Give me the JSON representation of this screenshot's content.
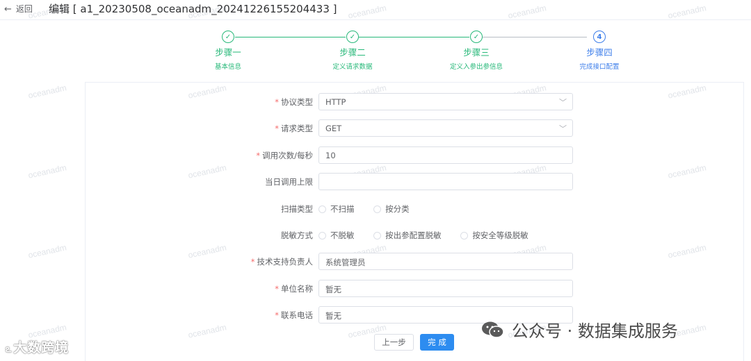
{
  "header": {
    "back_label": "返回",
    "title": "编辑 [ a1_20230508_oceanadm_20241226155204433 ]"
  },
  "watermark": "oceanadm",
  "steps": [
    {
      "title": "步骤一",
      "desc": "基本信息",
      "status": "done",
      "marker": "✓"
    },
    {
      "title": "步骤二",
      "desc": "定义请求数据",
      "status": "done",
      "marker": "✓"
    },
    {
      "title": "步骤三",
      "desc": "定义入参出参信息",
      "status": "done",
      "marker": "✓"
    },
    {
      "title": "步骤四",
      "desc": "完成接口配置",
      "status": "active",
      "marker": "4"
    }
  ],
  "form": {
    "protocol": {
      "label": "协议类型",
      "required": true,
      "value": "HTTP"
    },
    "request": {
      "label": "请求类型",
      "required": true,
      "value": "GET"
    },
    "rate": {
      "label": "调用次数/每秒",
      "required": true,
      "value": "10"
    },
    "daily_limit": {
      "label": "当日调用上限",
      "required": false,
      "value": ""
    },
    "scan": {
      "label": "扫描类型",
      "options": [
        "不扫描",
        "按分类"
      ]
    },
    "mask": {
      "label": "脱敏方式",
      "options": [
        "不脱敏",
        "按出参配置脱敏",
        "按安全等级脱敏"
      ]
    },
    "owner": {
      "label": "技术支持负责人",
      "required": true,
      "value": "系统管理员"
    },
    "unit": {
      "label": "单位名称",
      "required": true,
      "value": "暂无"
    },
    "phone": {
      "label": "联系电话",
      "required": true,
      "value": "暂无"
    }
  },
  "actions": {
    "prev": "上一步",
    "done": "完 成"
  },
  "overlays": {
    "left_brand": "大数跨境",
    "right_brand": "公众号 · 数据集成服务"
  },
  "colors": {
    "done": "#27b879",
    "active": "#3d7eea",
    "primary_button": "#2d8cf0",
    "required": "#f56c6c"
  }
}
